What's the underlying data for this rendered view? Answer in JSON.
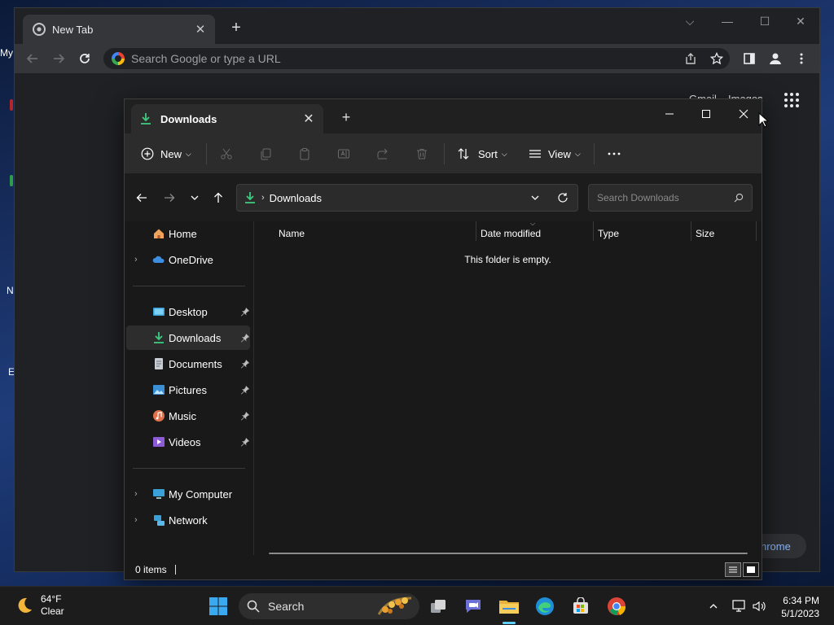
{
  "desktop": {
    "icon_labels": [
      "My",
      "N",
      "E"
    ]
  },
  "chrome": {
    "tab_title": "New Tab",
    "omnibox_placeholder": "Search Google or type a URL",
    "links": {
      "gmail": "Gmail",
      "images": "Images"
    },
    "customize_label": "hrome"
  },
  "explorer": {
    "tab_title": "Downloads",
    "commands": {
      "new_label": "New",
      "sort_label": "Sort",
      "view_label": "View"
    },
    "address": {
      "crumb": "Downloads"
    },
    "search_placeholder": "Search Downloads",
    "nav": {
      "home": "Home",
      "onedrive": "OneDrive",
      "quick_access": [
        {
          "label": "Desktop",
          "icon": "desktop-folder-icon"
        },
        {
          "label": "Downloads",
          "icon": "downloads-folder-icon",
          "selected": true
        },
        {
          "label": "Documents",
          "icon": "documents-folder-icon"
        },
        {
          "label": "Pictures",
          "icon": "pictures-folder-icon"
        },
        {
          "label": "Music",
          "icon": "music-folder-icon"
        },
        {
          "label": "Videos",
          "icon": "videos-folder-icon"
        }
      ],
      "my_computer": "My Computer",
      "network": "Network"
    },
    "columns": {
      "name": "Name",
      "date_modified": "Date modified",
      "type": "Type",
      "size": "Size"
    },
    "empty_message": "This folder is empty.",
    "status": "0 items"
  },
  "taskbar": {
    "weather": {
      "temp": "64°F",
      "condition": "Clear"
    },
    "search_label": "Search",
    "clock": {
      "time": "6:34 PM",
      "date": "5/1/2023"
    }
  },
  "colors": {
    "accent": "#60cdff",
    "download_green": "#3ccb7f",
    "explorer_bg": "#191919",
    "chrome_bg": "#202124"
  }
}
